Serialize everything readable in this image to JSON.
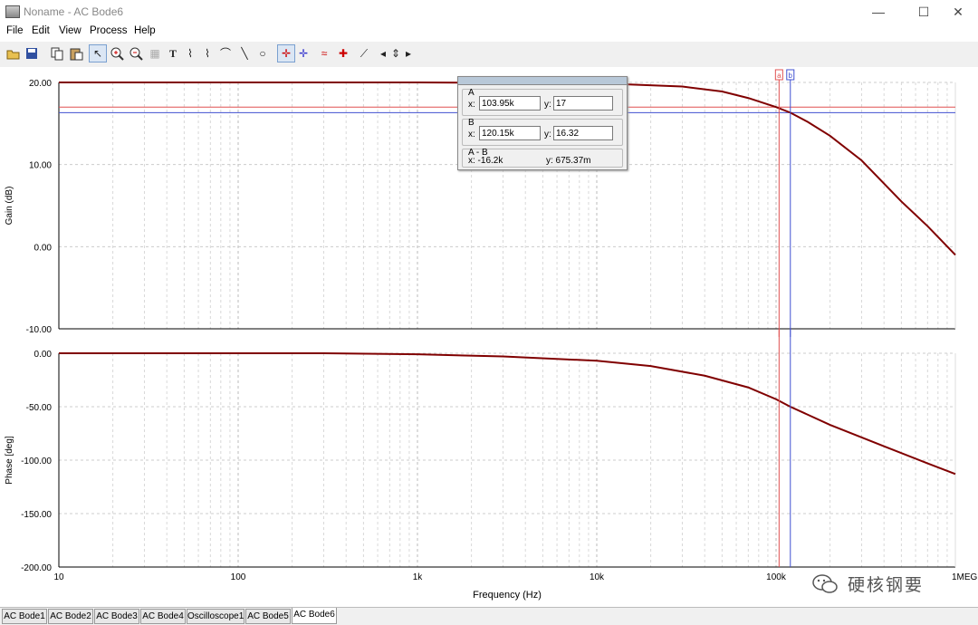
{
  "window": {
    "title": "Noname - AC Bode6",
    "minimize": "—",
    "maximize": "☐",
    "close": "✕"
  },
  "menu": [
    "File",
    "Edit",
    "View",
    "Process",
    "Help"
  ],
  "toolbar_icons": [
    "open-icon",
    "save-icon",
    "copy-icon",
    "paste-icon",
    "pointer-icon",
    "zoom-in-icon",
    "zoom-out-icon",
    "grid-icon",
    "text-icon",
    "label-icon",
    "label2-icon",
    "label3-icon",
    "line-icon",
    "ellipse-icon",
    "cursor-a-icon",
    "cursor-b-icon",
    "wave-icon",
    "marker-icon",
    "slope-icon",
    "left-arrow-icon",
    "updown-icon",
    "right-arrow-icon"
  ],
  "cursor_panel": {
    "a_label": "A",
    "a_x_label": "x:",
    "a_x": "103.95k",
    "a_y_label": "y:",
    "a_y": "17",
    "b_label": "B",
    "b_x_label": "x:",
    "b_x": "120.15k",
    "b_y_label": "y:",
    "b_y": "16.32",
    "diff_label": "A - B",
    "diff_x": "x:  -16.2k",
    "diff_y": "y:  675.37m"
  },
  "chart_data": [
    {
      "type": "line",
      "ylabel": "Gain (dB)",
      "xscale": "log",
      "xlim": [
        10,
        1000000
      ],
      "ylim": [
        -10,
        20
      ],
      "yticks": [
        "20.00",
        "10.00",
        "0.00",
        "-10.00"
      ],
      "grid": true,
      "series": [
        {
          "color": "#800000",
          "x": [
            10,
            1000,
            10000,
            30000,
            50000,
            70000,
            100000,
            120150,
            150000,
            200000,
            300000,
            500000,
            700000,
            1000000
          ],
          "y": [
            20,
            20,
            19.9,
            19.5,
            18.9,
            18.1,
            17,
            16.32,
            15.2,
            13.5,
            10.5,
            5.5,
            2.5,
            -1
          ]
        }
      ],
      "cursors": [
        {
          "label": "a",
          "x": 103950,
          "y": 17,
          "color": "#e05050"
        },
        {
          "label": "b",
          "x": 120150,
          "y": 16.32,
          "color": "#4050d0"
        }
      ]
    },
    {
      "type": "line",
      "ylabel": "Phase [deg]",
      "xlabel": "Frequency (Hz)",
      "xscale": "log",
      "xlim": [
        10,
        1000000
      ],
      "ylim": [
        -200,
        0
      ],
      "yticks": [
        "0.00",
        "-50.00",
        "-100.00",
        "-150.00",
        "-200.00"
      ],
      "xticks": [
        "10",
        "100",
        "1k",
        "10k",
        "100k",
        "1MEG"
      ],
      "grid": true,
      "series": [
        {
          "color": "#800000",
          "x": [
            10,
            100,
            300,
            1000,
            3000,
            10000,
            20000,
            40000,
            70000,
            100000,
            120000,
            200000,
            400000,
            700000,
            1000000
          ],
          "y": [
            0,
            0,
            0,
            -1,
            -3,
            -7,
            -12,
            -21,
            -32,
            -43,
            -50,
            -67,
            -87,
            -103,
            -113
          ]
        }
      ],
      "cursors": [
        {
          "label": "a",
          "x": 103950,
          "color": "#e05050"
        },
        {
          "label": "b",
          "x": 120150,
          "color": "#4050d0"
        }
      ]
    }
  ],
  "tabs": [
    "AC Bode1",
    "AC Bode2",
    "AC Bode3",
    "AC Bode4",
    "Oscilloscope1",
    "AC Bode5",
    "AC Bode6"
  ],
  "active_tab": "AC Bode6",
  "watermark": "硬核钢要"
}
